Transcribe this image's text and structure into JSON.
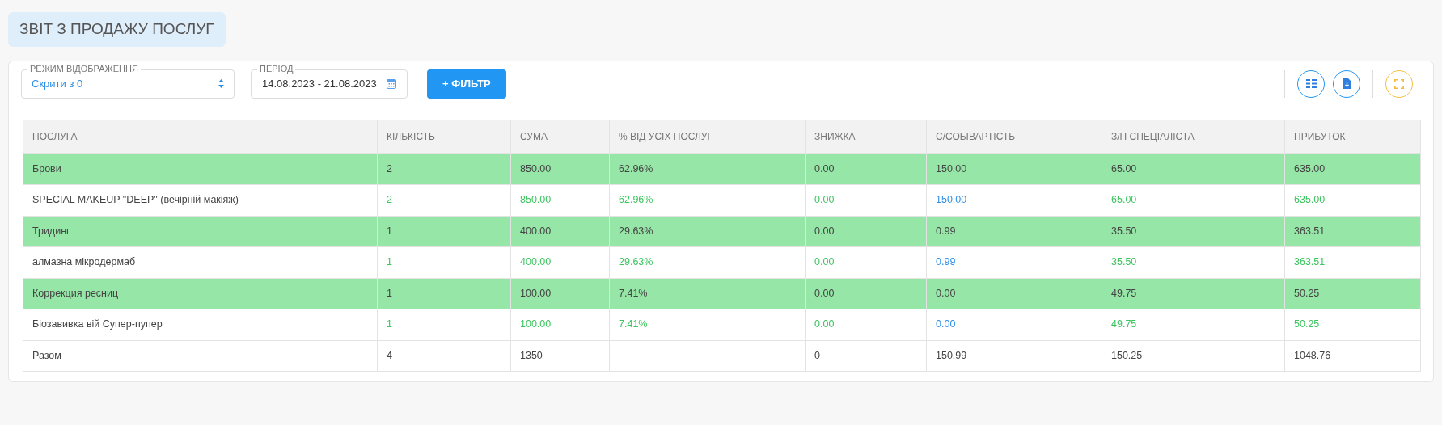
{
  "page_title": "ЗВІТ З ПРОДАЖУ ПОСЛУГ",
  "toolbar": {
    "display_mode": {
      "label": "РЕЖИМ ВІДОБРАЖЕННЯ",
      "value": "Скрити з 0"
    },
    "period": {
      "label": "ПЕРІОД",
      "value": "14.08.2023 - 21.08.2023"
    },
    "filter_button": "+ ФІЛЬТР"
  },
  "table": {
    "columns": [
      {
        "label": "ПОСЛУГА",
        "kind": "name"
      },
      {
        "label": "КІЛЬКІСТЬ",
        "kind": "value"
      },
      {
        "label": "СУМА",
        "kind": "value"
      },
      {
        "label": "% ВІД УСІХ ПОСЛУГ",
        "kind": "value"
      },
      {
        "label": "ЗНИЖКА",
        "kind": "value"
      },
      {
        "label": "С/СОБІВАРТІСТЬ",
        "kind": "cost"
      },
      {
        "label": "З/П СПЕЦІАЛІСТА",
        "kind": "value"
      },
      {
        "label": "ПРИБУТОК",
        "kind": "value"
      }
    ],
    "rows": [
      {
        "kind": "group",
        "cells": [
          "Брови",
          "2",
          "850.00",
          "62.96%",
          "0.00",
          "150.00",
          "65.00",
          "635.00"
        ]
      },
      {
        "kind": "item",
        "cells": [
          "SPECIAL MAKEUP \"DEEP\" (вечірній макіяж)",
          "2",
          "850.00",
          "62.96%",
          "0.00",
          "150.00",
          "65.00",
          "635.00"
        ]
      },
      {
        "kind": "group",
        "cells": [
          "Тридинг",
          "1",
          "400.00",
          "29.63%",
          "0.00",
          "0.99",
          "35.50",
          "363.51"
        ]
      },
      {
        "kind": "item",
        "cells": [
          "алмазна мікродермаб",
          "1",
          "400.00",
          "29.63%",
          "0.00",
          "0.99",
          "35.50",
          "363.51"
        ]
      },
      {
        "kind": "group",
        "cells": [
          "Коррекция ресниц",
          "1",
          "100.00",
          "7.41%",
          "0.00",
          "0.00",
          "49.75",
          "50.25"
        ]
      },
      {
        "kind": "item",
        "cells": [
          "Біозавивка вій Супер-пупер",
          "1",
          "100.00",
          "7.41%",
          "0.00",
          "0.00",
          "49.75",
          "50.25"
        ]
      },
      {
        "kind": "total",
        "cells": [
          "Разом",
          "4",
          "1350",
          "",
          "0",
          "150.99",
          "150.25",
          "1048.76"
        ]
      }
    ]
  }
}
